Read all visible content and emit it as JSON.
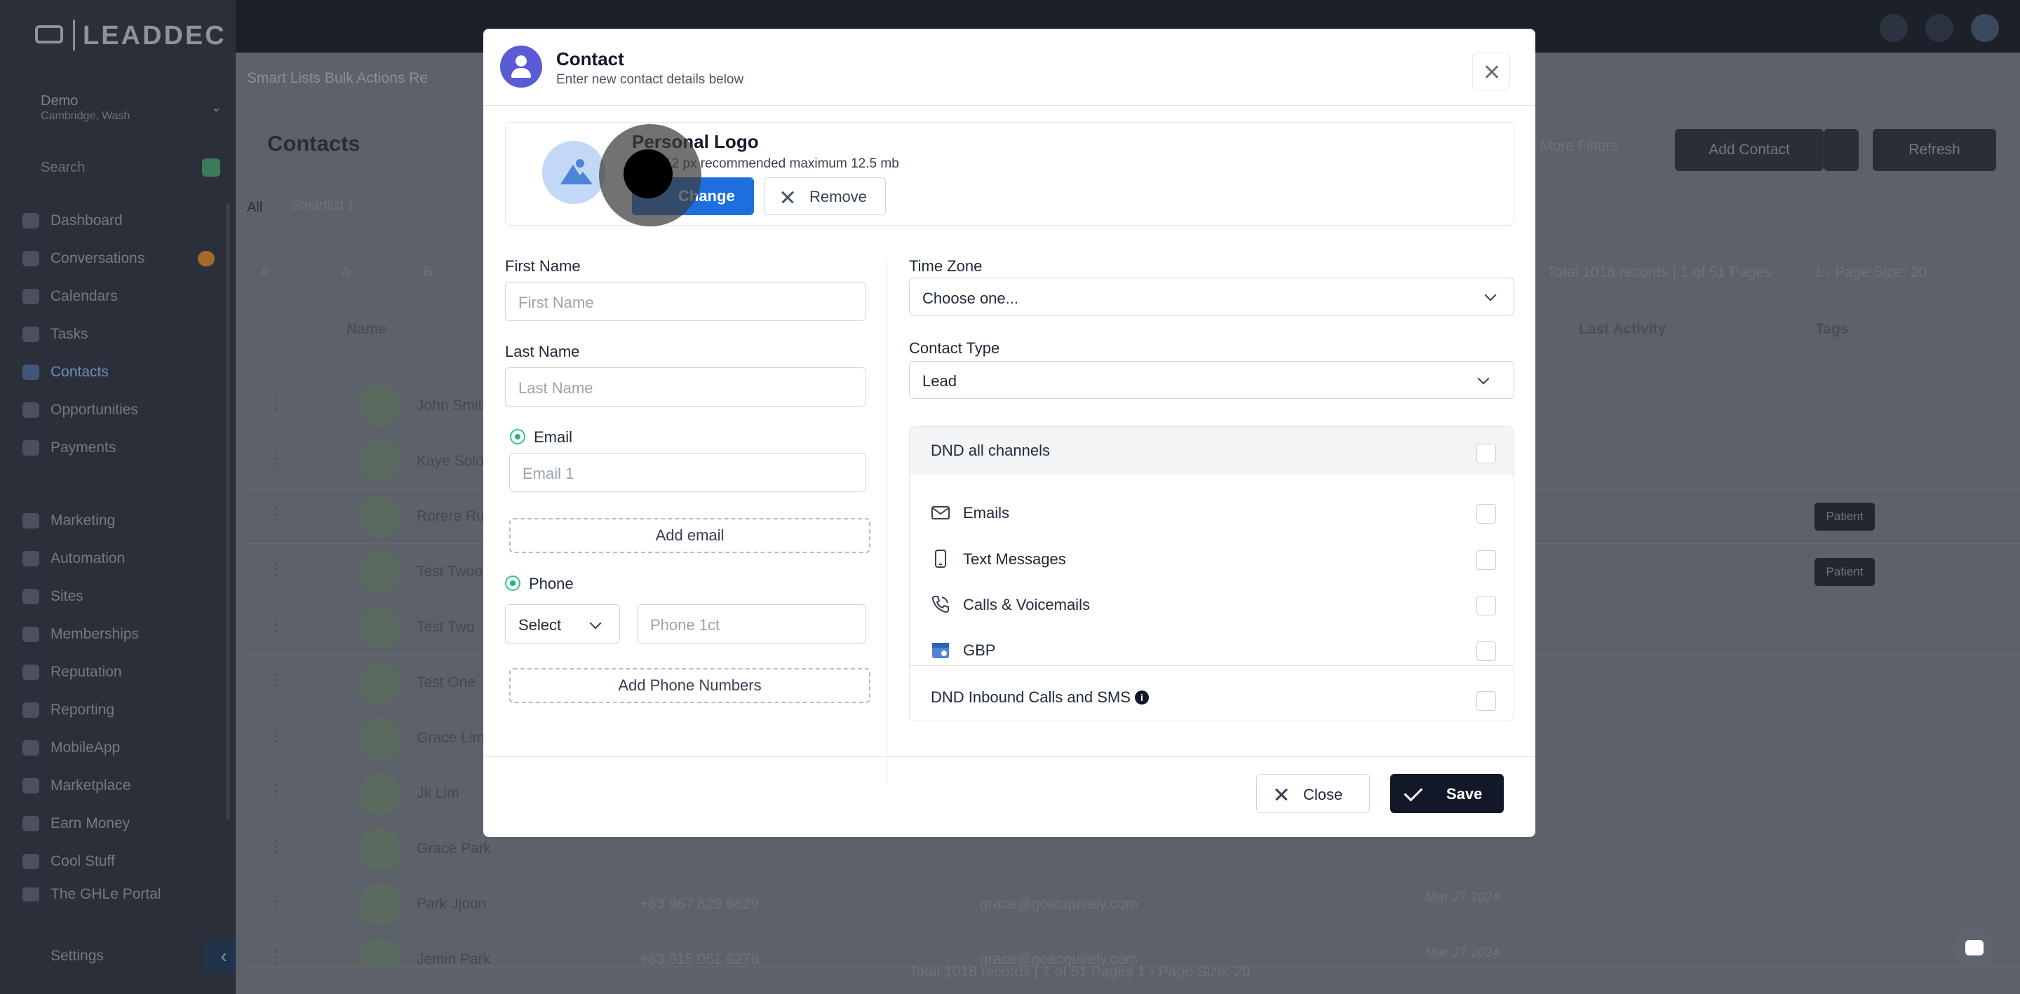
{
  "background": {
    "brand": "LEADDEC",
    "account": {
      "name": "Demo",
      "sub": "Cambridge, Wash"
    },
    "search_label": "Search",
    "nav": [
      {
        "label": "Dashboard"
      },
      {
        "label": "Conversations"
      },
      {
        "label": "Calendars"
      },
      {
        "label": "Tasks"
      },
      {
        "label": "Contacts"
      },
      {
        "label": "Opportunities"
      },
      {
        "label": "Payments"
      },
      {
        "label": "Marketing"
      },
      {
        "label": "Automation"
      },
      {
        "label": "Sites"
      },
      {
        "label": "Memberships"
      },
      {
        "label": "Reputation"
      },
      {
        "label": "Reporting"
      },
      {
        "label": "MobileApp"
      },
      {
        "label": "Marketplace"
      },
      {
        "label": "Earn Money"
      },
      {
        "label": "Cool Stuff"
      },
      {
        "label": "The GHLe Portal"
      }
    ],
    "settings_label": "Settings",
    "tabs": "Smart Lists    Bulk Actions    Re",
    "page_title": "Contacts",
    "filter_all": "All",
    "filter_smartlist": "Smartlist 1",
    "letters": "# A B C D E",
    "more_filters": "More Filters",
    "add_contact": "Add Contact",
    "refresh": "Refresh",
    "total_text": "Total 1018 records | 1 of 51 Pages",
    "pager_text": "1   ›   Page Size: 20",
    "columns": {
      "name": "Name",
      "last_activity": "Last Activity",
      "tags": "Tags"
    },
    "rows": [
      {
        "name": "John Smith",
        "tag": ""
      },
      {
        "name": "Kaye Solom",
        "tag": ""
      },
      {
        "name": "Rorere Ruh",
        "tag": "Patient"
      },
      {
        "name": "Test Twoo",
        "tag": "Patient"
      },
      {
        "name": "Test Two",
        "tag": ""
      },
      {
        "name": "Test One",
        "tag": ""
      },
      {
        "name": "Grace Lim",
        "tag": ""
      },
      {
        "name": "Jk Lim",
        "tag": ""
      },
      {
        "name": "Grace Park",
        "tag": ""
      },
      {
        "name": "Park Jjoon",
        "tag": "",
        "phone": "+63 967 829 6829",
        "email": "grace@goacquirely.com",
        "date": "Mar 27 2024"
      },
      {
        "name": "Jemin Park",
        "tag": "",
        "phone": "+63 915 051 6276",
        "email": "grace@goacquirely.com",
        "date": "Mar 27 2024"
      }
    ],
    "footer_total": "Total 1018 records | 1 of 51 Pages   1   ›   Page Size: 20"
  },
  "modal": {
    "title": "Contact",
    "subtitle": "Enter new contact details below",
    "logo": {
      "title": "Personal Logo",
      "hint": "12 px recommended maximum 12.5 mb",
      "change_label": "Change",
      "remove_label": "Remove"
    },
    "first_name": {
      "label": "First Name",
      "placeholder": "First Name"
    },
    "last_name": {
      "label": "Last Name",
      "placeholder": "Last Name"
    },
    "email": {
      "label": "Email",
      "placeholder": "Email 1",
      "add_label": "Add email"
    },
    "phone": {
      "label": "Phone",
      "select_value": "Select",
      "placeholder": "Phone 1ct",
      "add_label": "Add Phone Numbers"
    },
    "time_zone": {
      "label": "Time Zone",
      "value": "Choose one..."
    },
    "contact_type": {
      "label": "Contact Type",
      "value": "Lead"
    },
    "dnd": {
      "all_label": "DND all channels",
      "channels": [
        {
          "label": "Emails",
          "icon": "envelope-icon"
        },
        {
          "label": "Text Messages",
          "icon": "mobile-phone-icon"
        },
        {
          "label": "Calls & Voicemails",
          "icon": "phone-call-icon"
        },
        {
          "label": "GBP",
          "icon": "google-business-icon"
        }
      ],
      "inbound_label": "DND Inbound Calls and SMS"
    },
    "close_label": "Close",
    "save_label": "Save"
  },
  "colors": {
    "primary": "#1d6fde",
    "accent_green": "#10b981",
    "dark": "#111827",
    "avatar": "#5b5bd6"
  }
}
